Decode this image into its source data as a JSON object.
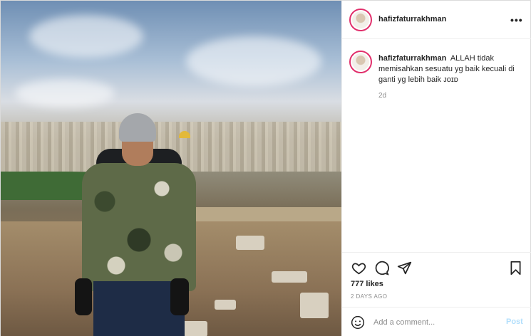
{
  "post": {
    "username": "hafizfaturrakhman",
    "caption": "ALLAH tidak memisahkan sesuatu yg baik kecuali di ganti yg lebih baik ᴊᴏɪᴅ",
    "caption_age": "2d",
    "likes": "777 likes",
    "timestamp": "2 DAYS AGO"
  },
  "header": {
    "more_icon": "•••"
  },
  "comment": {
    "placeholder": "Add a comment...",
    "post_label": "Post"
  },
  "icons": {
    "like": "heart-icon",
    "comment": "comment-icon",
    "share": "paper-plane-icon",
    "save": "bookmark-icon",
    "emoji": "emoji-icon"
  },
  "colors": {
    "story_ring": "#e1306c",
    "post_button_disabled": "#b2dffc",
    "secondary_text": "#8e8e8e"
  }
}
